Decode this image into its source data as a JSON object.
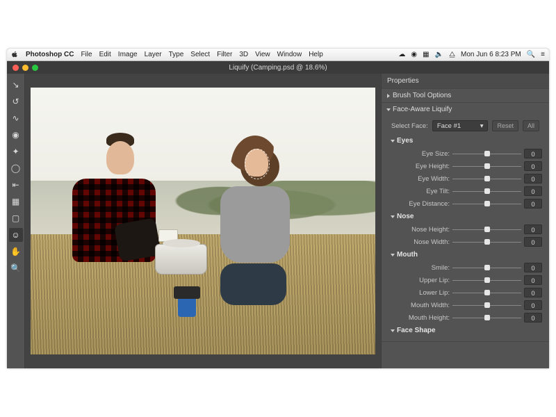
{
  "menubar": {
    "app_name": "Photoshop CC",
    "menus": [
      "File",
      "Edit",
      "Image",
      "Layer",
      "Type",
      "Select",
      "Filter",
      "3D",
      "View",
      "Window",
      "Help"
    ],
    "datetime": "Mon Jun 6  8:23 PM"
  },
  "window": {
    "title": "Liquify (Camping.psd @ 18.6%)"
  },
  "tools": [
    {
      "name": "forward-warp",
      "glyph": "↘"
    },
    {
      "name": "reconstruct",
      "glyph": "↺"
    },
    {
      "name": "smooth",
      "glyph": "∿"
    },
    {
      "name": "twirl",
      "glyph": "◉"
    },
    {
      "name": "pucker",
      "glyph": "✦"
    },
    {
      "name": "bloat",
      "glyph": "◯"
    },
    {
      "name": "push-left",
      "glyph": "⇤"
    },
    {
      "name": "freeze-mask",
      "glyph": "▦"
    },
    {
      "name": "thaw-mask",
      "glyph": "▢"
    },
    {
      "name": "face",
      "glyph": "☺",
      "active": true
    },
    {
      "name": "hand",
      "glyph": "✋"
    },
    {
      "name": "zoom",
      "glyph": "🔍"
    }
  ],
  "panel": {
    "title": "Properties",
    "brush_section": "Brush Tool Options",
    "face_section": "Face-Aware Liquify",
    "select_face_label": "Select Face:",
    "select_face_value": "Face #1",
    "reset_label": "Reset",
    "all_label": "All",
    "groups": [
      {
        "name": "Eyes",
        "rows": [
          {
            "label": "Eye Size:",
            "value": "0"
          },
          {
            "label": "Eye Height:",
            "value": "0"
          },
          {
            "label": "Eye Width:",
            "value": "0"
          },
          {
            "label": "Eye Tilt:",
            "value": "0"
          },
          {
            "label": "Eye Distance:",
            "value": "0"
          }
        ]
      },
      {
        "name": "Nose",
        "rows": [
          {
            "label": "Nose Height:",
            "value": "0"
          },
          {
            "label": "Nose Width:",
            "value": "0"
          }
        ]
      },
      {
        "name": "Mouth",
        "rows": [
          {
            "label": "Smile:",
            "value": "0"
          },
          {
            "label": "Upper Lip:",
            "value": "0"
          },
          {
            "label": "Lower Lip:",
            "value": "0"
          },
          {
            "label": "Mouth Width:",
            "value": "0"
          },
          {
            "label": "Mouth Height:",
            "value": "0"
          }
        ]
      }
    ],
    "face_shape_label": "Face Shape"
  }
}
